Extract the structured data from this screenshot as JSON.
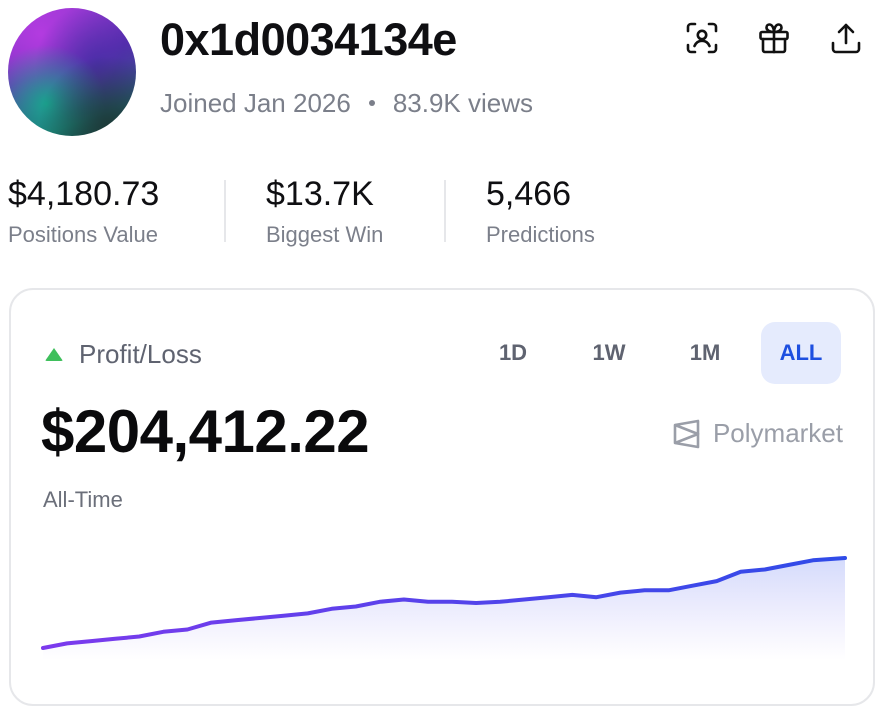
{
  "profile": {
    "username": "0x1d0034134e",
    "joined": "Joined Jan 2026",
    "views": "83.9K views"
  },
  "header_icons": [
    "scan-profile-icon",
    "gift-icon",
    "share-upload-icon"
  ],
  "stats": [
    {
      "value": "$4,180.73",
      "label": "Positions Value"
    },
    {
      "value": "$13.7K",
      "label": "Biggest Win"
    },
    {
      "value": "5,466",
      "label": "Predictions"
    }
  ],
  "pnl": {
    "label": "Profit/Loss",
    "amount": "$204,412.22",
    "period": "All-Time",
    "brand": "Polymarket",
    "ranges": [
      "1D",
      "1W",
      "1M",
      "ALL"
    ],
    "active_range": "ALL",
    "up_color": "#3fbf5c",
    "accent_color": "#1d4fe0"
  },
  "chart_data": {
    "type": "area",
    "title": "",
    "xlabel": "",
    "ylabel": "",
    "grid": false,
    "x": [
      0,
      3,
      6,
      9,
      12,
      15,
      18,
      21,
      24,
      27,
      30,
      33,
      36,
      39,
      42,
      45,
      48,
      51,
      54,
      57,
      60,
      63,
      66,
      69,
      72,
      75,
      78,
      81,
      84,
      87,
      90,
      93,
      96,
      100
    ],
    "series": [
      {
        "values": [
          0,
          2,
          3,
          4,
          5,
          7,
          8,
          11,
          12,
          13,
          14,
          15,
          17,
          18,
          20,
          21,
          20,
          20,
          19.5,
          20,
          21,
          22,
          23,
          22,
          24,
          25,
          25,
          27,
          29,
          33,
          34,
          36,
          38,
          39
        ],
        "color_start": "#7c3aed",
        "color_end": "#2f4be8"
      }
    ]
  }
}
